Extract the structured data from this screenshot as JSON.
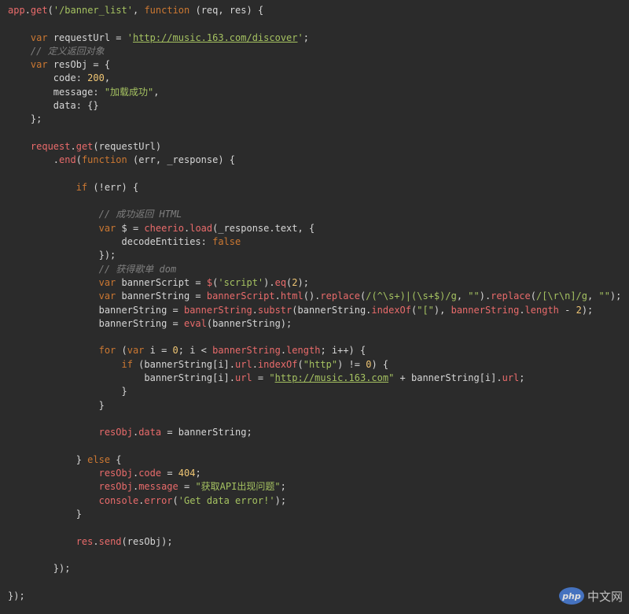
{
  "colors": {
    "background": "#2b2b2b",
    "text": "#d6d6d6",
    "keyword": "#cc7832",
    "string": "#a5c261",
    "number": "#f0c674",
    "comment": "#7f7f7f",
    "function": "#e96b6b"
  },
  "code": {
    "lines": [
      [
        [
          "fn",
          "app"
        ],
        [
          "pun",
          "."
        ],
        [
          "fn",
          "get"
        ],
        [
          "pun",
          "("
        ],
        [
          "str",
          "'/banner_list'"
        ],
        [
          "pun",
          ", "
        ],
        [
          "kw",
          "function"
        ],
        [
          "pun",
          " (req, res) {"
        ]
      ],
      [],
      [
        [
          "pun",
          "    "
        ],
        [
          "kw",
          "var"
        ],
        [
          "id",
          " requestUrl = "
        ],
        [
          "str",
          "'"
        ],
        [
          "link",
          "http://music.163.com/discover"
        ],
        [
          "str",
          "'"
        ],
        [
          "pun",
          ";"
        ]
      ],
      [
        [
          "cmt",
          "    // 定义返回对象"
        ]
      ],
      [
        [
          "pun",
          "    "
        ],
        [
          "kw",
          "var"
        ],
        [
          "id",
          " resObj = {"
        ]
      ],
      [
        [
          "prop",
          "        code: "
        ],
        [
          "num",
          "200"
        ],
        [
          "pun",
          ","
        ]
      ],
      [
        [
          "prop",
          "        message: "
        ],
        [
          "str",
          "\"加载成功\""
        ],
        [
          "pun",
          ","
        ]
      ],
      [
        [
          "prop",
          "        data: {}"
        ]
      ],
      [
        [
          "pun",
          "    };"
        ]
      ],
      [],
      [
        [
          "pun",
          "    "
        ],
        [
          "fn",
          "request"
        ],
        [
          "pun",
          "."
        ],
        [
          "fn",
          "get"
        ],
        [
          "pun",
          "(requestUrl)"
        ]
      ],
      [
        [
          "pun",
          "        ."
        ],
        [
          "fn",
          "end"
        ],
        [
          "pun",
          "("
        ],
        [
          "kw",
          "function"
        ],
        [
          "pun",
          " (err, _response) {"
        ]
      ],
      [],
      [
        [
          "pun",
          "            "
        ],
        [
          "kw",
          "if"
        ],
        [
          "pun",
          " (!err) {"
        ]
      ],
      [],
      [
        [
          "cmt",
          "                // 成功返回 HTML"
        ]
      ],
      [
        [
          "pun",
          "                "
        ],
        [
          "kw",
          "var"
        ],
        [
          "id",
          " $ = "
        ],
        [
          "fn",
          "cheerio"
        ],
        [
          "pun",
          "."
        ],
        [
          "fn",
          "load"
        ],
        [
          "pun",
          "(_response.text, {"
        ]
      ],
      [
        [
          "prop",
          "                    decodeEntities: "
        ],
        [
          "bool",
          "false"
        ]
      ],
      [
        [
          "pun",
          "                });"
        ]
      ],
      [
        [
          "cmt",
          "                // 获得歌单 dom"
        ]
      ],
      [
        [
          "pun",
          "                "
        ],
        [
          "kw",
          "var"
        ],
        [
          "id",
          " bannerScript = "
        ],
        [
          "fn",
          "$"
        ],
        [
          "pun",
          "("
        ],
        [
          "str",
          "'script'"
        ],
        [
          "pun",
          ")."
        ],
        [
          "fn",
          "eq"
        ],
        [
          "pun",
          "("
        ],
        [
          "num",
          "2"
        ],
        [
          "pun",
          ");"
        ]
      ],
      [
        [
          "pun",
          "                "
        ],
        [
          "kw",
          "var"
        ],
        [
          "id",
          " bannerString = "
        ],
        [
          "fn",
          "bannerScript"
        ],
        [
          "pun",
          "."
        ],
        [
          "fn",
          "html"
        ],
        [
          "pun",
          "()."
        ],
        [
          "fn",
          "replace"
        ],
        [
          "pun",
          "("
        ],
        [
          "str",
          "/(^\\s+)|(\\s+$)/g"
        ],
        [
          "pun",
          ", "
        ],
        [
          "str",
          "\"\""
        ],
        [
          "pun",
          ")."
        ],
        [
          "fn",
          "replace"
        ],
        [
          "pun",
          "("
        ],
        [
          "str",
          "/[\\r\\n]/g"
        ],
        [
          "pun",
          ", "
        ],
        [
          "str",
          "\"\""
        ],
        [
          "pun",
          ");"
        ]
      ],
      [
        [
          "pun",
          "                bannerString = "
        ],
        [
          "fn",
          "bannerString"
        ],
        [
          "pun",
          "."
        ],
        [
          "fn",
          "substr"
        ],
        [
          "pun",
          "(bannerString."
        ],
        [
          "fn",
          "indexOf"
        ],
        [
          "pun",
          "("
        ],
        [
          "str",
          "\"[\""
        ],
        [
          "pun",
          "), "
        ],
        [
          "fn",
          "bannerString"
        ],
        [
          "pun",
          "."
        ],
        [
          "fn",
          "length"
        ],
        [
          "pun",
          " - "
        ],
        [
          "num",
          "2"
        ],
        [
          "pun",
          ");"
        ]
      ],
      [
        [
          "pun",
          "                bannerString = "
        ],
        [
          "fn",
          "eval"
        ],
        [
          "pun",
          "(bannerString);"
        ]
      ],
      [],
      [
        [
          "pun",
          "                "
        ],
        [
          "kw",
          "for"
        ],
        [
          "pun",
          " ("
        ],
        [
          "kw",
          "var"
        ],
        [
          "pun",
          " i = "
        ],
        [
          "num",
          "0"
        ],
        [
          "pun",
          "; i < "
        ],
        [
          "fn",
          "bannerString"
        ],
        [
          "pun",
          "."
        ],
        [
          "fn",
          "length"
        ],
        [
          "pun",
          "; i++) {"
        ]
      ],
      [
        [
          "pun",
          "                    "
        ],
        [
          "kw",
          "if"
        ],
        [
          "pun",
          " (bannerString[i]."
        ],
        [
          "fn",
          "url"
        ],
        [
          "pun",
          "."
        ],
        [
          "fn",
          "indexOf"
        ],
        [
          "pun",
          "("
        ],
        [
          "str",
          "\"http\""
        ],
        [
          "pun",
          ") != "
        ],
        [
          "num",
          "0"
        ],
        [
          "pun",
          ") {"
        ]
      ],
      [
        [
          "pun",
          "                        bannerString[i]."
        ],
        [
          "fn",
          "url"
        ],
        [
          "pun",
          " = "
        ],
        [
          "str",
          "\""
        ],
        [
          "link",
          "http://music.163.com"
        ],
        [
          "str",
          "\""
        ],
        [
          "pun",
          " + bannerString[i]."
        ],
        [
          "fn",
          "url"
        ],
        [
          "pun",
          ";"
        ]
      ],
      [
        [
          "pun",
          "                    }"
        ]
      ],
      [
        [
          "pun",
          "                }"
        ]
      ],
      [],
      [
        [
          "pun",
          "                "
        ],
        [
          "fn",
          "resObj"
        ],
        [
          "pun",
          "."
        ],
        [
          "fn",
          "data"
        ],
        [
          "pun",
          " = bannerString;"
        ]
      ],
      [],
      [
        [
          "pun",
          "            } "
        ],
        [
          "kw",
          "else"
        ],
        [
          "pun",
          " {"
        ]
      ],
      [
        [
          "pun",
          "                "
        ],
        [
          "fn",
          "resObj"
        ],
        [
          "pun",
          "."
        ],
        [
          "fn",
          "code"
        ],
        [
          "pun",
          " = "
        ],
        [
          "num",
          "404"
        ],
        [
          "pun",
          ";"
        ]
      ],
      [
        [
          "pun",
          "                "
        ],
        [
          "fn",
          "resObj"
        ],
        [
          "pun",
          "."
        ],
        [
          "fn",
          "message"
        ],
        [
          "pun",
          " = "
        ],
        [
          "str",
          "\"获取API出现问题\""
        ],
        [
          "pun",
          ";"
        ]
      ],
      [
        [
          "pun",
          "                "
        ],
        [
          "fn",
          "console"
        ],
        [
          "pun",
          "."
        ],
        [
          "fn",
          "error"
        ],
        [
          "pun",
          "("
        ],
        [
          "str",
          "'Get data error!'"
        ],
        [
          "pun",
          ");"
        ]
      ],
      [
        [
          "pun",
          "            }"
        ]
      ],
      [],
      [
        [
          "pun",
          "            "
        ],
        [
          "fn",
          "res"
        ],
        [
          "pun",
          "."
        ],
        [
          "fn",
          "send"
        ],
        [
          "pun",
          "(resObj);"
        ]
      ],
      [],
      [
        [
          "pun",
          "        });"
        ]
      ],
      [],
      [
        [
          "pun",
          "});"
        ]
      ]
    ]
  },
  "watermark": {
    "logo_text": "php",
    "site_text": "中文网"
  }
}
